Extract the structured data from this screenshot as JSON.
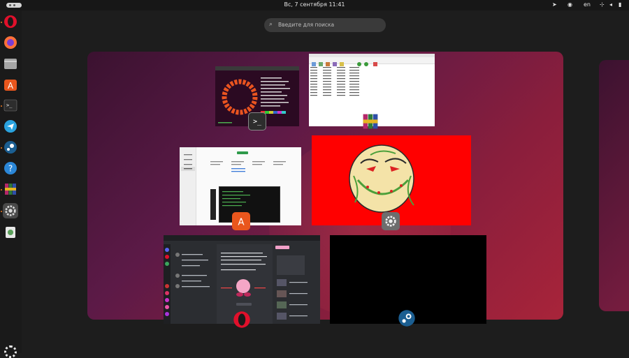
{
  "topbar": {
    "clock": "Вс, 7 сентября  11:41",
    "language": "en"
  },
  "search": {
    "placeholder": "Введите для поиска"
  },
  "dock": {
    "items": [
      {
        "name": "opera",
        "color": "#e0102b"
      },
      {
        "name": "firefox",
        "color": "#ff7139"
      },
      {
        "name": "files",
        "color": "#9a9a9a"
      },
      {
        "name": "app-center",
        "color": "#e9561d"
      },
      {
        "name": "terminal",
        "color": "#2d2d2d"
      },
      {
        "name": "telegram",
        "color": "#2aa3df"
      },
      {
        "name": "steam",
        "color": "#1b5e91"
      },
      {
        "name": "help",
        "color": "#2b87d8"
      },
      {
        "name": "winrar",
        "color": "#8a2a6a"
      },
      {
        "name": "settings",
        "color": "#7d7d7d"
      },
      {
        "name": "trash",
        "color": "#5aa05a"
      }
    ]
  },
  "windows": {
    "terminal_prompt": ">_"
  },
  "colors": {
    "accent": "#e95420",
    "topbar": "#171717",
    "dock": "#1a1a1a",
    "red_window": "#ff0000"
  }
}
